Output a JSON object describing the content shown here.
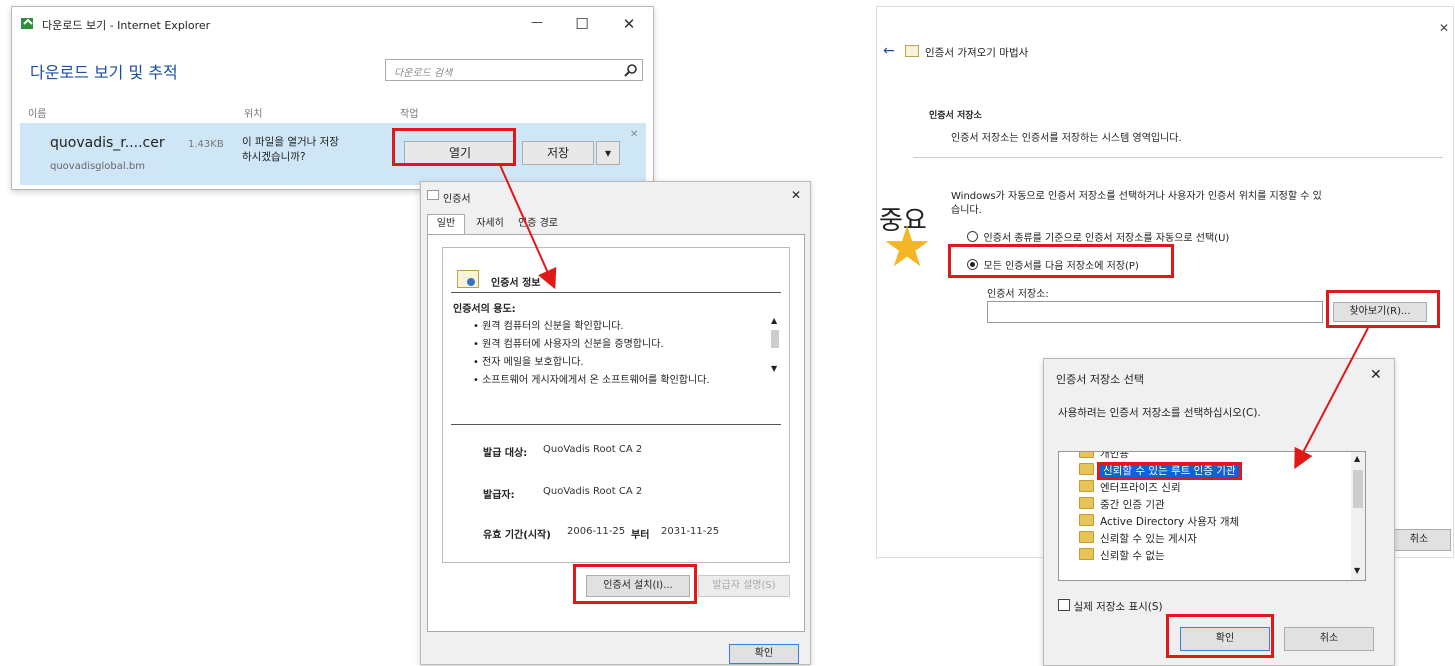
{
  "download_window": {
    "title": "다운로드 보기 - Internet Explorer",
    "heading": "다운로드 보기 및 추적",
    "search_placeholder": "다운로드 검색",
    "minimize": "—",
    "maximize": "☐",
    "close": "✕",
    "columns": {
      "name": "이름",
      "location": "위치",
      "action": "작업"
    },
    "item": {
      "filename": "quovadis_r....cer",
      "size": "1.43KB",
      "source": "quovadisglobal.bm",
      "prompt_line1": "이 파일을 열거나 저장",
      "prompt_line2": "하시겠습니까?",
      "open": "열기",
      "save": "저장",
      "dropdown": "▾",
      "dismiss": "✕"
    }
  },
  "cert_dialog": {
    "title": "인증서",
    "close": "✕",
    "tabs": [
      "일반",
      "자세히",
      "인증 경로"
    ],
    "info_title": "인증서 정보",
    "purpose_heading": "인증서의 용도:",
    "purposes": [
      "• 원격 컴퓨터의 신분을 확인합니다.",
      "• 원격 컴퓨터에 사용자의 신분을 증명합니다.",
      "• 전자 메일을 보호합니다.",
      "• 소프트웨어 게시자에게서 온 소프트웨어를 확인합니다."
    ],
    "issued_to_label": "발급 대상:",
    "issued_to_value": "QuoVadis Root CA 2",
    "issued_by_label": "발급자:",
    "issued_by_value": "QuoVadis Root CA 2",
    "validity_label": "유효 기간(시작)",
    "valid_from": "2006-11-25",
    "validity_to_word": "부터",
    "valid_to": "2031-11-25",
    "install_button": "인증서 설치(I)...",
    "issuer_statement_button": "발급자 설명(S)",
    "ok_button": "확인"
  },
  "import_wizard": {
    "title": "인증서 가져오기 마법사",
    "back": "←",
    "close": "✕",
    "section_title": "인증서 저장소",
    "section_desc": "인증서 저장소는 인증서를 저장하는 시스템 영역입니다.",
    "instruction_line1": "Windows가 자동으로 인증서 저장소를 선택하거나 사용자가 인증서 위치를 지정할 수 있",
    "instruction_line2": "습니다.",
    "radio_auto": "인증서 종류를 기준으로 인증서 저장소를 자동으로 선택(U)",
    "radio_manual": "모든 인증서를 다음 저장소에 저장(P)",
    "store_label": "인증서 저장소:",
    "store_value": "",
    "browse_button": "찾아보기(R)...",
    "cancel_button": "취소",
    "important_badge": "중요",
    "star_glyph": "★"
  },
  "store_picker": {
    "title": "인증서 저장소 선택",
    "close": "✕",
    "prompt": "사용하려는 인증서 저장소를 선택하십시오(C).",
    "items": [
      "개인용",
      "신뢰할 수 있는 루트 인증 기관",
      "엔터프라이즈 신뢰",
      "중간 인증 기관",
      "Active Directory 사용자 개체",
      "신뢰할 수 있는 게시자",
      "신뢰할 수 없는"
    ],
    "selected_index": 1,
    "show_physical": "실제 저장소 표시(S)",
    "ok_button": "확인",
    "cancel_button": "취소"
  },
  "colors": {
    "highlight": "#e01818",
    "selection": "#0a64d8",
    "link_blue": "#1a4f9c",
    "star": "#f4b626"
  }
}
